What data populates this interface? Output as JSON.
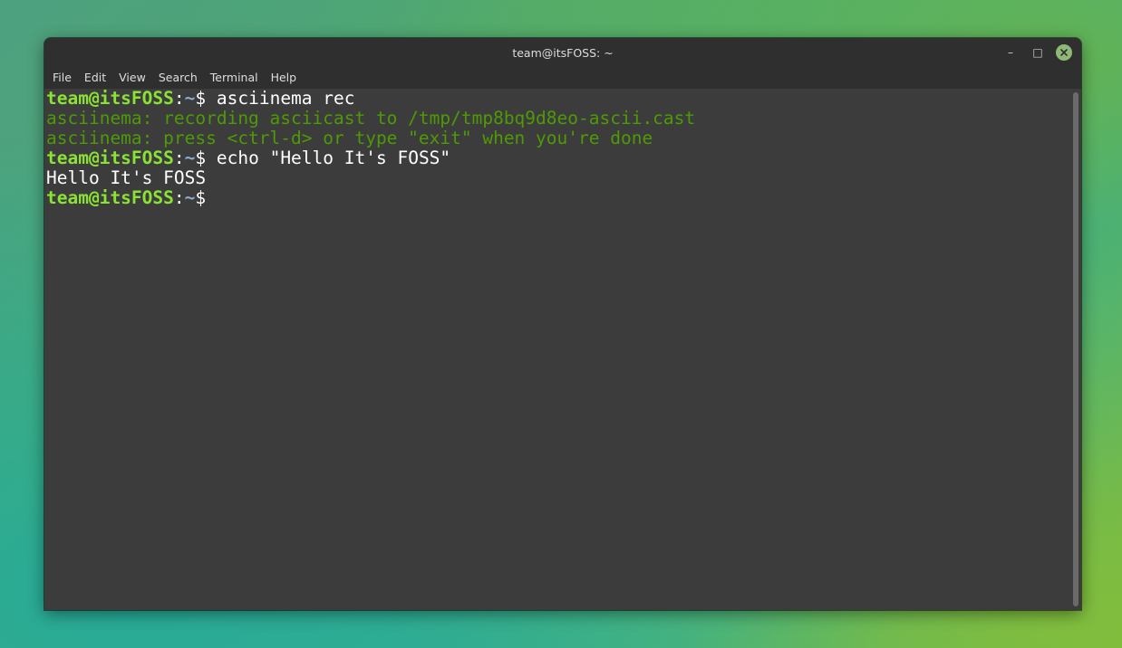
{
  "window": {
    "title": "team@itsFOSS: ~",
    "controls": {
      "minimize": "–",
      "maximize": "□",
      "close": "✕"
    }
  },
  "menubar": {
    "items": [
      "File",
      "Edit",
      "View",
      "Search",
      "Terminal",
      "Help"
    ]
  },
  "terminal": {
    "prompt": {
      "user_host": "team@itsFOSS",
      "colon": ":",
      "path": "~",
      "symbol": "$"
    },
    "lines": [
      {
        "type": "command",
        "command": " asciinema rec"
      },
      {
        "type": "info",
        "text": "asciinema: recording asciicast to /tmp/tmp8bq9d8eo-ascii.cast"
      },
      {
        "type": "info",
        "text": "asciinema: press <ctrl-d> or type \"exit\" when you're done"
      },
      {
        "type": "command",
        "command": " echo \"Hello It's FOSS\""
      },
      {
        "type": "output",
        "text": "Hello It's FOSS"
      },
      {
        "type": "command",
        "command": ""
      }
    ]
  },
  "colors": {
    "prompt_user": "#8ae234",
    "prompt_path": "#8aaed2",
    "info_text": "#4e9a06",
    "terminal_bg": "#3c3c3c",
    "titlebar_bg": "#2f2f2f",
    "close_button": "#8fb877"
  }
}
